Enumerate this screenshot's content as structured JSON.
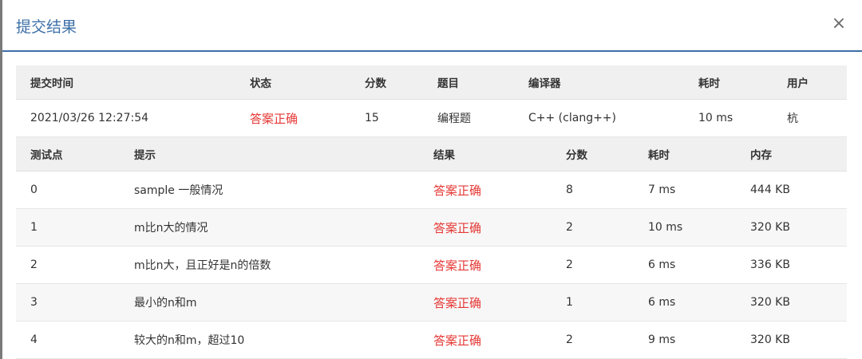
{
  "modal": {
    "title": "提交结果",
    "close_label": "×"
  },
  "summary": {
    "headers": [
      "提交时间",
      "状态",
      "分数",
      "题目",
      "编译器",
      "耗时",
      "用户"
    ],
    "row": [
      "2021/03/26 12:27:54",
      "答案正确",
      "15",
      "编程题",
      "C++ (clang++)",
      "10 ms",
      "杭"
    ]
  },
  "tests": {
    "headers": [
      "测试点",
      "提示",
      "结果",
      "分数",
      "耗时",
      "内存"
    ],
    "rows": [
      [
        "0",
        "sample 一般情况",
        "答案正确",
        "8",
        "7 ms",
        "444 KB"
      ],
      [
        "1",
        "m比n大的情况",
        "答案正确",
        "2",
        "10 ms",
        "320 KB"
      ],
      [
        "2",
        "m比n大，且正好是n的倍数",
        "答案正确",
        "2",
        "6 ms",
        "336 KB"
      ],
      [
        "3",
        "最小的n和m",
        "答案正确",
        "1",
        "6 ms",
        "320 KB"
      ],
      [
        "4",
        "较大的n和m，超过10",
        "答案正确",
        "2",
        "9 ms",
        "320 KB"
      ]
    ]
  },
  "colors": {
    "accent": "#3d6fa8",
    "success_text": "#e53935"
  }
}
